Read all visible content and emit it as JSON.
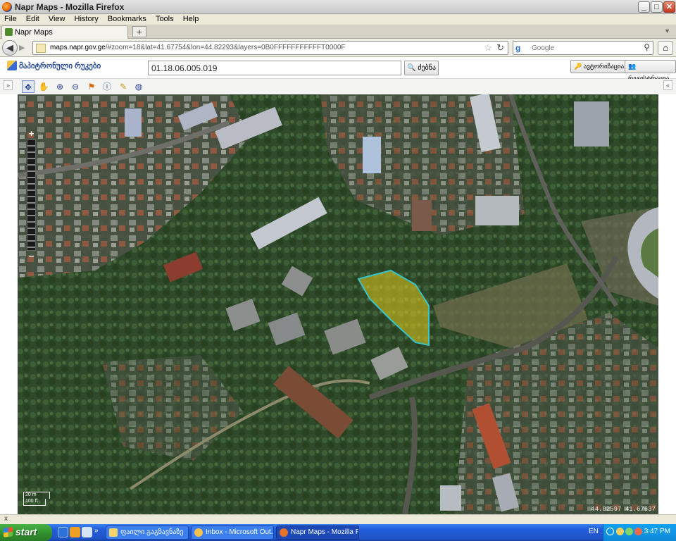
{
  "window": {
    "title": "Napr Maps - Mozilla Firefox",
    "controls": {
      "minimize": "_",
      "maximize": "□",
      "close": "✕"
    }
  },
  "menu": {
    "items": [
      "File",
      "Edit",
      "View",
      "History",
      "Bookmarks",
      "Tools",
      "Help"
    ]
  },
  "tabs": [
    {
      "label": "Napr Maps"
    }
  ],
  "new_tab_label": "+",
  "nav": {
    "url_host": "maps.napr.gov.ge",
    "url_rest": "/#zoom=18&lat=41.67754&lon=44.82293&layers=0B0FFFFFFFFFFFT0000F",
    "search_placeholder": "Google"
  },
  "app": {
    "logo_text": "მაპიტრონული რუკები",
    "cadastral_code": "01.18.06.005.019",
    "search_button": "ძებნა",
    "header_buttons": [
      "ავტორიზაცია",
      "რეგისტრაცია"
    ]
  },
  "map_toolbar": {
    "left_toggle": "»",
    "right_toggle": "«",
    "tools": [
      "pan-icon",
      "hand-icon",
      "zoom-in-icon",
      "zoom-out-icon",
      "measure-icon",
      "info-icon",
      "pencil-icon",
      "globe-icon"
    ]
  },
  "map": {
    "zoom_plus": "+",
    "zoom_minus": "−",
    "scale_top": "20 m",
    "scale_bottom": "100 ft",
    "coordinates": "44.82597 41.67637",
    "parcel_color": "#d4c21e"
  },
  "status": {
    "close_symbol": "x"
  },
  "taskbar": {
    "start_label": "start",
    "tasks": [
      {
        "label": "ფაილი გაგზავნაზე",
        "active": false
      },
      {
        "label": "Inbox - Microsoft Out...",
        "active": false
      },
      {
        "label": "Napr Maps - Mozilla Fi...",
        "active": true
      }
    ],
    "language": "EN",
    "clock": "3:47 PM"
  }
}
